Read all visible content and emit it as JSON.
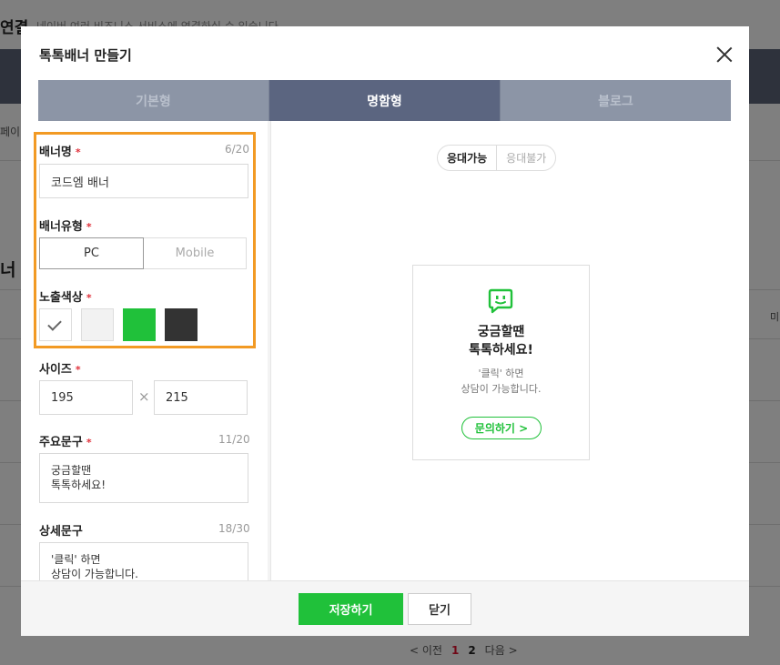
{
  "background": {
    "title": "연결",
    "subtitle": "네이버 여러 비즈니스 서비스에 연결하실 수 있습니다.",
    "left_text_1": "페이",
    "left_text_2": "너 만",
    "right_char": "미",
    "pagination": {
      "prev": "< 이전",
      "page_1": "1",
      "page_2": "2",
      "next": "다음 >"
    }
  },
  "modal": {
    "title": "톡톡배너 만들기",
    "tabs": [
      {
        "label": "기본형"
      },
      {
        "label": "명함형"
      },
      {
        "label": "블로그"
      }
    ],
    "active_tab": "명함형",
    "form": {
      "banner_name": {
        "label": "배너명",
        "required": "*",
        "count": "6/20",
        "value": "코드엠 배너"
      },
      "banner_type": {
        "label": "배너유형",
        "required": "*",
        "options": [
          "PC",
          "Mobile"
        ],
        "selected": "PC"
      },
      "color": {
        "label": "노출색상",
        "required": "*",
        "swatches": [
          "#ffffff",
          "#f2f2f2",
          "#20c13a",
          "#333333"
        ],
        "selected": "#ffffff"
      },
      "size": {
        "label": "사이즈",
        "required": "*",
        "width": "195",
        "separator": "×",
        "height": "215"
      },
      "main_text": {
        "label": "주요문구",
        "required": "*",
        "count": "11/20",
        "value": "궁금할땐\n톡톡하세요!"
      },
      "detail_text": {
        "label": "상세문구",
        "count": "18/30",
        "value": "'클릭' 하면\n상담이 가능합니다."
      }
    },
    "preview": {
      "toggle": [
        "응대가능",
        "응대불가"
      ],
      "toggle_selected": "응대가능",
      "banner": {
        "main": "궁금할땐\n톡톡하세요!",
        "sub": "'클릭' 하면\n상담이 가능합니다.",
        "button": "문의하기 >"
      }
    },
    "footer": {
      "save": "저장하기",
      "cancel": "닫기"
    }
  },
  "colors": {
    "accent_green": "#20c13a",
    "tab_active": "#5b6580",
    "tab_inactive": "#8c95a6",
    "highlight": "#f29a24"
  }
}
